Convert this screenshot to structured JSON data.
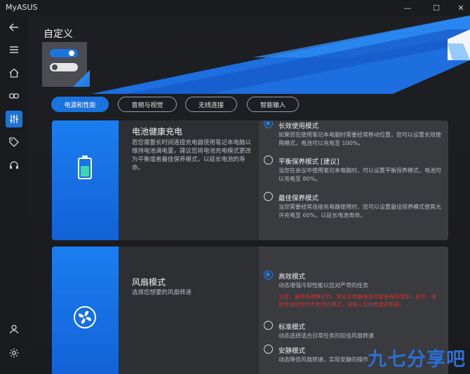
{
  "app": {
    "title": "MyASUS"
  },
  "window": {
    "minimize": "—",
    "maximize": "☐",
    "close": "✕"
  },
  "page": {
    "title": "自定义"
  },
  "sidebar": {
    "items": [
      {
        "icon": "back-arrow-icon"
      },
      {
        "icon": "menu-icon"
      },
      {
        "icon": "home-icon"
      },
      {
        "icon": "link-icon"
      },
      {
        "icon": "sliders-icon",
        "active": true
      },
      {
        "icon": "tag-icon"
      },
      {
        "icon": "headset-icon"
      },
      {
        "icon": "user-icon"
      },
      {
        "icon": "gear-icon"
      }
    ]
  },
  "tabs": [
    {
      "label": "电源和性能",
      "active": true
    },
    {
      "label": "音频与视觉"
    },
    {
      "label": "无线连接"
    },
    {
      "label": "智能输入"
    }
  ],
  "battery": {
    "title": "电池健康充电",
    "desc": "若您需要长时间连接充电器使用笔记本电脑以维持电池满电量，建议您将电池充电模式更改为平衡或者最佳保养模式，以延长电池的寿命。",
    "options": [
      {
        "label": "长效使用模式",
        "desc": "如果您在使用笔记本电脑时需要经常移动位置，您可以设置长效使用模式，电池可以充电至 100%。",
        "selected": true
      },
      {
        "label": "平衡保养模式 [建议]",
        "desc": "当您在会议中使用笔记本电脑时，可以设置平衡保养模式，电池可以充电至 80%。"
      },
      {
        "label": "最佳保养模式",
        "desc": "当您需要经常连接充电器使用时，您可以设置最佳保养模式使其允许充电至 60%，以延长电池寿命。"
      }
    ]
  },
  "fan": {
    "title": "风扇模式",
    "desc": "选择您想要的风扇转速",
    "options": [
      {
        "label": "高效模式",
        "desc": "动态增强冷却性能以应对严苛的任务",
        "selected": true,
        "warning": "注意：使用高效模式时，笔记本电脑噪音可能会有所增加。此外，使用电池供电时不支持此模式，请插入您的电源适配器。"
      },
      {
        "label": "标准模式",
        "desc": "动态选择适合日常任务的较佳风扇转速"
      },
      {
        "label": "安静模式",
        "desc": "动态降低风扇转速，实现安静的操作"
      }
    ]
  },
  "watermark": "九七分享吧",
  "colors": {
    "accent": "#1a74e0",
    "warning": "#d23232"
  }
}
